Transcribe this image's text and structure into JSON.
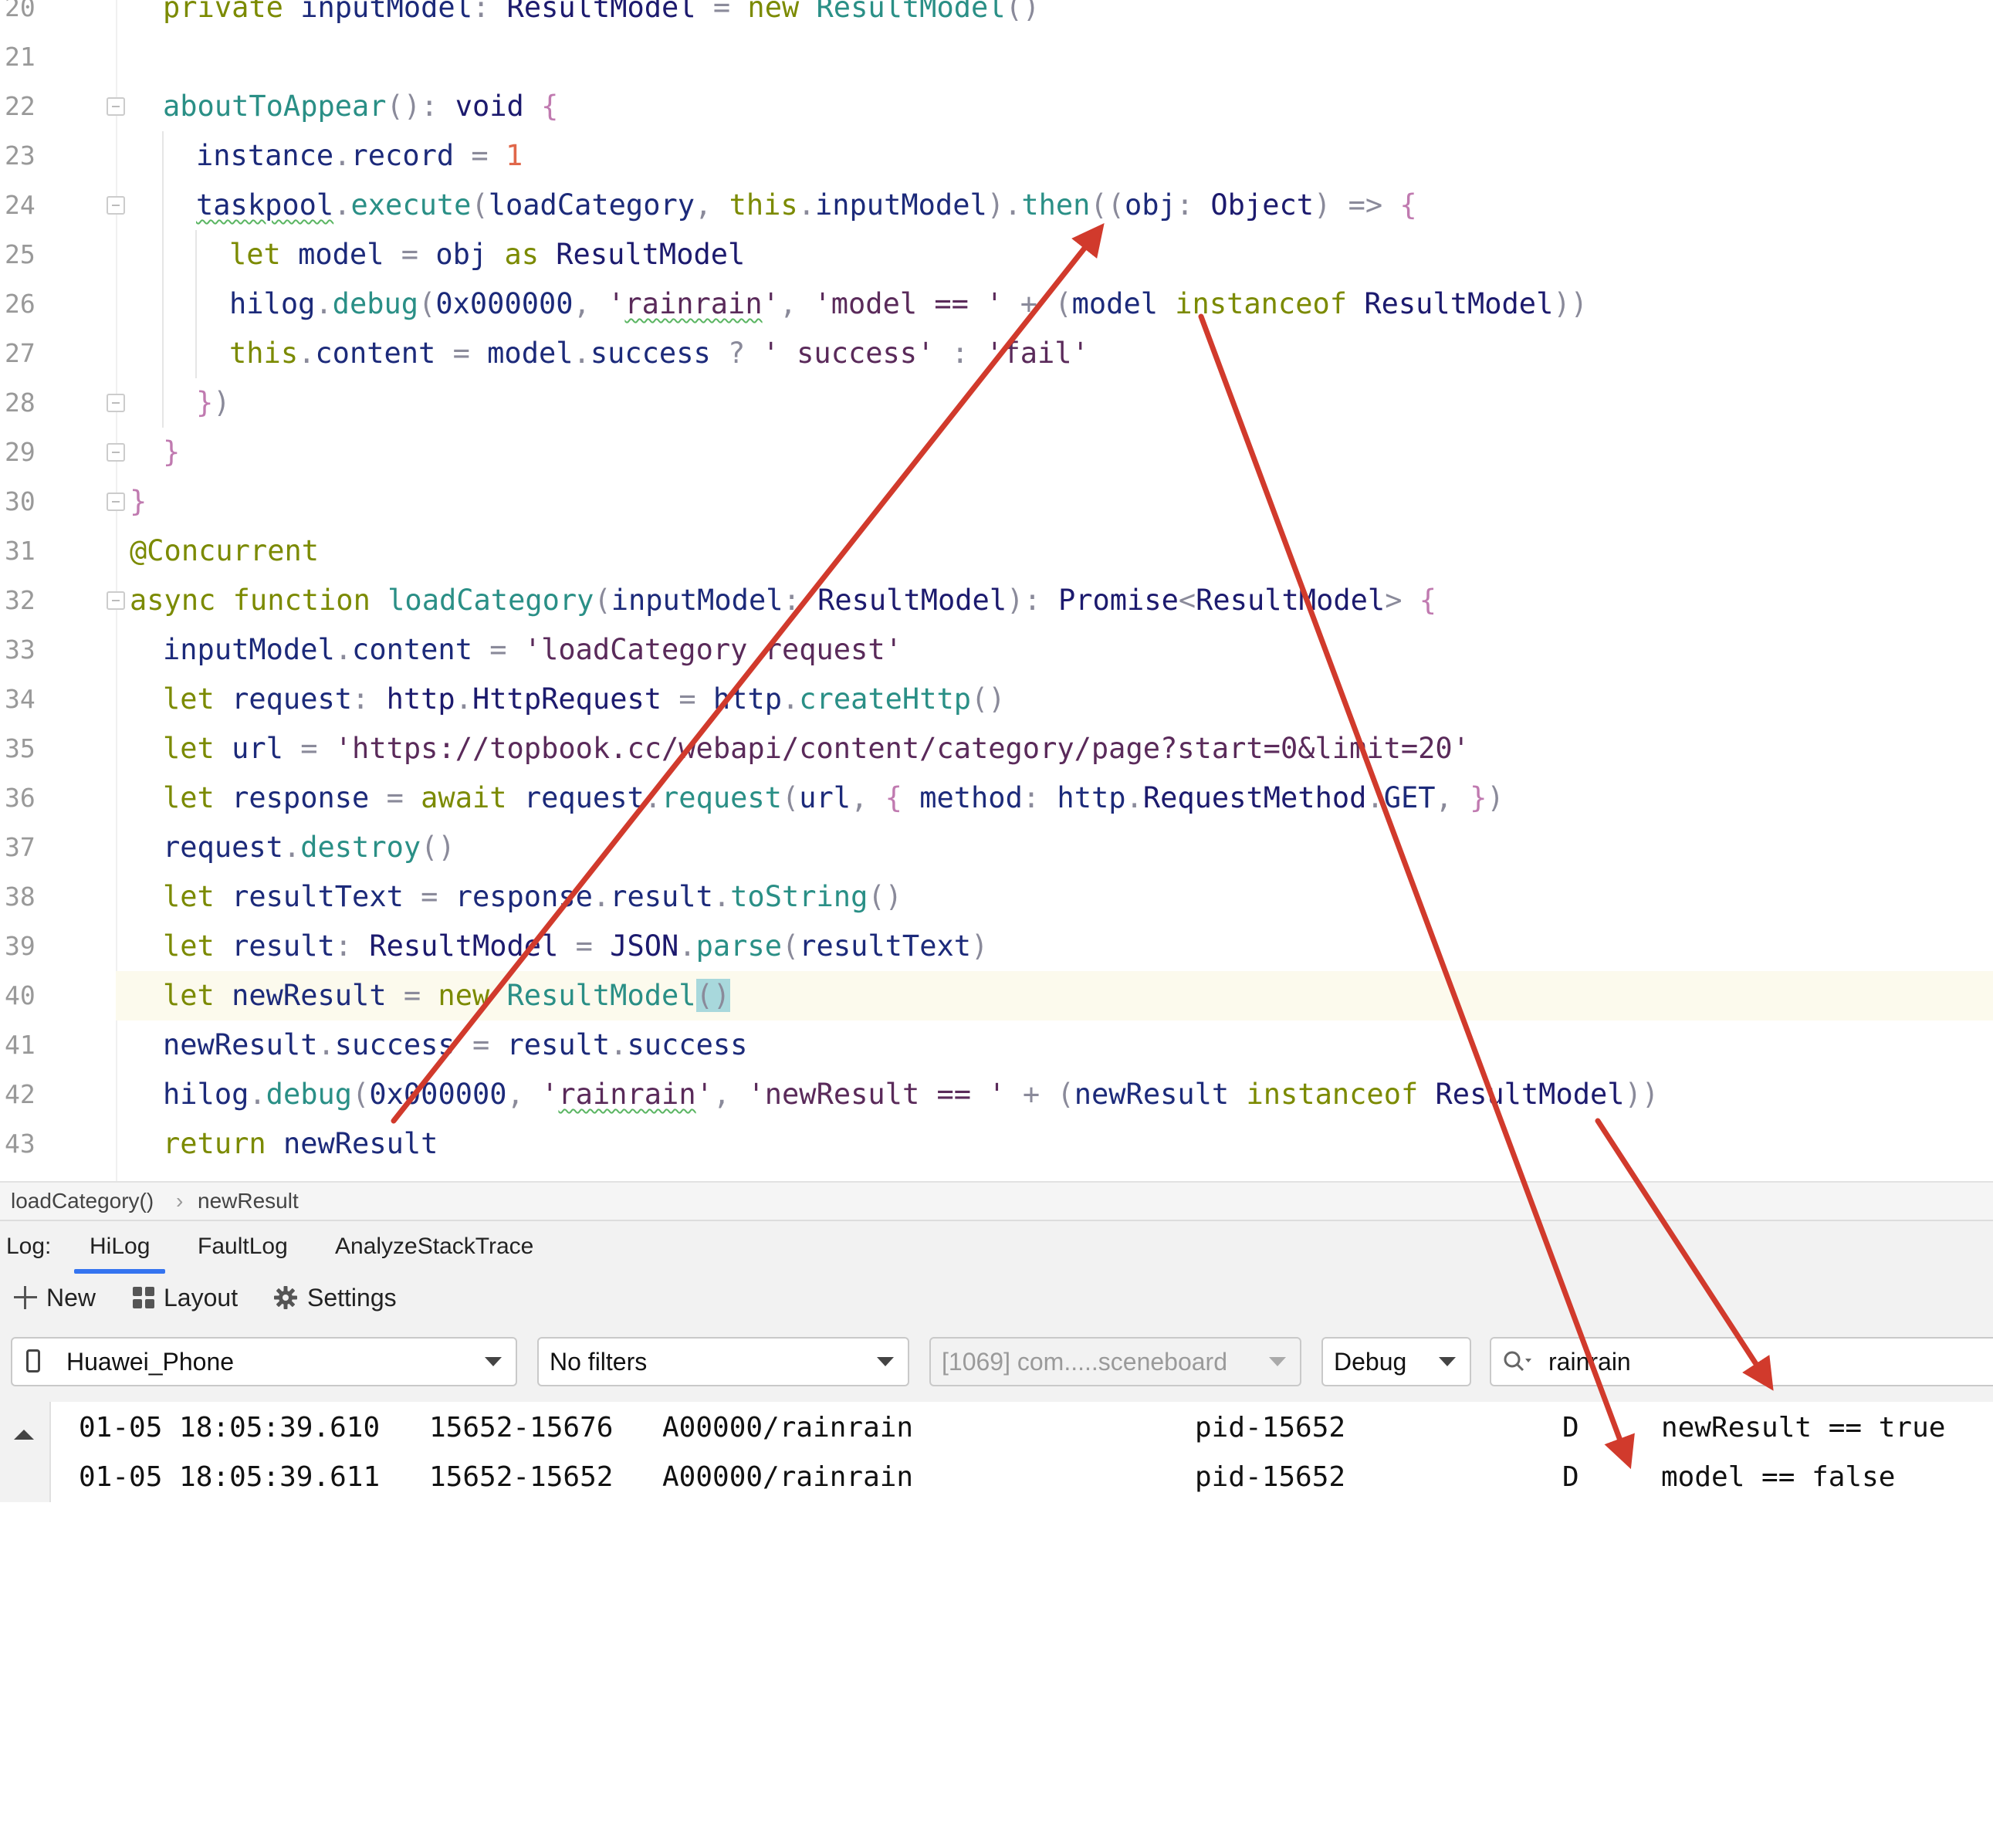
{
  "editor": {
    "lines": [
      {
        "n": "20",
        "indent": 1,
        "fold": false,
        "current": false,
        "tokens": [
          {
            "t": "private ",
            "c": "kw"
          },
          {
            "t": "inputModel",
            "c": "id"
          },
          {
            "t": ": ",
            "c": "pu"
          },
          {
            "t": "ResultModel",
            "c": "ty"
          },
          {
            "t": " = ",
            "c": "pu"
          },
          {
            "t": "new ",
            "c": "kw"
          },
          {
            "t": "ResultModel",
            "c": "fn"
          },
          {
            "t": "()",
            "c": "pu"
          }
        ]
      },
      {
        "n": "21",
        "indent": 0,
        "fold": false,
        "current": false,
        "tokens": []
      },
      {
        "n": "22",
        "indent": 1,
        "fold": true,
        "current": false,
        "tokens": [
          {
            "t": "aboutToAppear",
            "c": "fn"
          },
          {
            "t": "(): ",
            "c": "pu"
          },
          {
            "t": "void",
            "c": "ty"
          },
          {
            "t": " {",
            "c": "br"
          }
        ]
      },
      {
        "n": "23",
        "indent": 2,
        "fold": false,
        "current": false,
        "tokens": [
          {
            "t": "instance",
            "c": "id"
          },
          {
            "t": ".",
            "c": "pu"
          },
          {
            "t": "record",
            "c": "id"
          },
          {
            "t": " = ",
            "c": "pu"
          },
          {
            "t": "1",
            "c": "num"
          }
        ]
      },
      {
        "n": "24",
        "indent": 2,
        "fold": true,
        "current": false,
        "tokens": [
          {
            "t": "taskpool",
            "c": "id",
            "sq": true
          },
          {
            "t": ".",
            "c": "pu"
          },
          {
            "t": "execute",
            "c": "fn"
          },
          {
            "t": "(",
            "c": "pu"
          },
          {
            "t": "loadCategory",
            "c": "id"
          },
          {
            "t": ", ",
            "c": "pu"
          },
          {
            "t": "this",
            "c": "kw"
          },
          {
            "t": ".",
            "c": "pu"
          },
          {
            "t": "inputModel",
            "c": "id"
          },
          {
            "t": ").",
            "c": "pu"
          },
          {
            "t": "then",
            "c": "fn"
          },
          {
            "t": "((",
            "c": "pu"
          },
          {
            "t": "obj",
            "c": "id"
          },
          {
            "t": ": ",
            "c": "pu"
          },
          {
            "t": "Object",
            "c": "ty"
          },
          {
            "t": ") => ",
            "c": "pu"
          },
          {
            "t": "{",
            "c": "br"
          }
        ]
      },
      {
        "n": "25",
        "indent": 3,
        "fold": false,
        "current": false,
        "tokens": [
          {
            "t": "let ",
            "c": "kw"
          },
          {
            "t": "model",
            "c": "id"
          },
          {
            "t": " = ",
            "c": "pu"
          },
          {
            "t": "obj ",
            "c": "id"
          },
          {
            "t": "as ",
            "c": "kw"
          },
          {
            "t": "ResultModel",
            "c": "ty"
          }
        ]
      },
      {
        "n": "26",
        "indent": 3,
        "fold": false,
        "current": false,
        "tokens": [
          {
            "t": "hilog",
            "c": "id"
          },
          {
            "t": ".",
            "c": "pu"
          },
          {
            "t": "debug",
            "c": "fn"
          },
          {
            "t": "(",
            "c": "pu"
          },
          {
            "t": "0x000000",
            "c": "id"
          },
          {
            "t": ", ",
            "c": "pu"
          },
          {
            "t": "'",
            "c": "str"
          },
          {
            "t": "rainrain",
            "c": "str",
            "sq": true
          },
          {
            "t": "'",
            "c": "str"
          },
          {
            "t": ", ",
            "c": "pu"
          },
          {
            "t": "'model == '",
            "c": "str"
          },
          {
            "t": " + ",
            "c": "pu"
          },
          {
            "t": "(",
            "c": "pu"
          },
          {
            "t": "model ",
            "c": "id"
          },
          {
            "t": "instanceof ",
            "c": "kw"
          },
          {
            "t": "ResultModel",
            "c": "ty"
          },
          {
            "t": "))",
            "c": "pu"
          }
        ]
      },
      {
        "n": "27",
        "indent": 3,
        "fold": false,
        "current": false,
        "tokens": [
          {
            "t": "this",
            "c": "kw"
          },
          {
            "t": ".",
            "c": "pu"
          },
          {
            "t": "content",
            "c": "id"
          },
          {
            "t": " = ",
            "c": "pu"
          },
          {
            "t": "model",
            "c": "id"
          },
          {
            "t": ".",
            "c": "pu"
          },
          {
            "t": "success",
            "c": "id"
          },
          {
            "t": " ? ",
            "c": "pu"
          },
          {
            "t": "' success'",
            "c": "str"
          },
          {
            "t": " : ",
            "c": "pu"
          },
          {
            "t": "'fail'",
            "c": "str"
          }
        ]
      },
      {
        "n": "28",
        "indent": 2,
        "fold": true,
        "current": false,
        "tokens": [
          {
            "t": "}",
            "c": "br"
          },
          {
            "t": ")",
            "c": "pu"
          }
        ]
      },
      {
        "n": "29",
        "indent": 1,
        "fold": true,
        "current": false,
        "tokens": [
          {
            "t": "}",
            "c": "br"
          }
        ]
      },
      {
        "n": "30",
        "indent": 0,
        "fold": true,
        "current": false,
        "tokens": [
          {
            "t": "}",
            "c": "br"
          }
        ]
      },
      {
        "n": "31",
        "indent": 0,
        "fold": false,
        "current": false,
        "tokens": [
          {
            "t": "@Concurrent",
            "c": "dec"
          }
        ]
      },
      {
        "n": "32",
        "indent": 0,
        "fold": true,
        "current": false,
        "tokens": [
          {
            "t": "async ",
            "c": "kw"
          },
          {
            "t": "function ",
            "c": "kw"
          },
          {
            "t": "loadCategory",
            "c": "fn"
          },
          {
            "t": "(",
            "c": "pu"
          },
          {
            "t": "inputModel",
            "c": "id"
          },
          {
            "t": ": ",
            "c": "pu"
          },
          {
            "t": "ResultModel",
            "c": "ty"
          },
          {
            "t": "): ",
            "c": "pu"
          },
          {
            "t": "Promise",
            "c": "ty"
          },
          {
            "t": "<",
            "c": "pu"
          },
          {
            "t": "ResultModel",
            "c": "ty"
          },
          {
            "t": "> ",
            "c": "pu"
          },
          {
            "t": "{",
            "c": "br"
          }
        ]
      },
      {
        "n": "33",
        "indent": 1,
        "fold": false,
        "current": false,
        "tokens": [
          {
            "t": "inputModel",
            "c": "id"
          },
          {
            "t": ".",
            "c": "pu"
          },
          {
            "t": "content",
            "c": "id"
          },
          {
            "t": " = ",
            "c": "pu"
          },
          {
            "t": "'loadCategory request'",
            "c": "str"
          }
        ]
      },
      {
        "n": "34",
        "indent": 1,
        "fold": false,
        "current": false,
        "tokens": [
          {
            "t": "let ",
            "c": "kw"
          },
          {
            "t": "request",
            "c": "id"
          },
          {
            "t": ": ",
            "c": "pu"
          },
          {
            "t": "http",
            "c": "ty"
          },
          {
            "t": ".",
            "c": "pu"
          },
          {
            "t": "HttpRequest",
            "c": "ty"
          },
          {
            "t": " = ",
            "c": "pu"
          },
          {
            "t": "http",
            "c": "id"
          },
          {
            "t": ".",
            "c": "pu"
          },
          {
            "t": "createHttp",
            "c": "fn"
          },
          {
            "t": "()",
            "c": "pu"
          }
        ]
      },
      {
        "n": "35",
        "indent": 1,
        "fold": false,
        "current": false,
        "tokens": [
          {
            "t": "let ",
            "c": "kw"
          },
          {
            "t": "url",
            "c": "id"
          },
          {
            "t": " = ",
            "c": "pu"
          },
          {
            "t": "'https://topbook.cc/webapi/content/category/page?start=0&limit=20'",
            "c": "str"
          }
        ]
      },
      {
        "n": "36",
        "indent": 1,
        "fold": false,
        "current": false,
        "tokens": [
          {
            "t": "let ",
            "c": "kw"
          },
          {
            "t": "response",
            "c": "id"
          },
          {
            "t": " = ",
            "c": "pu"
          },
          {
            "t": "await ",
            "c": "kw"
          },
          {
            "t": "request",
            "c": "id"
          },
          {
            "t": ".",
            "c": "pu"
          },
          {
            "t": "request",
            "c": "fn"
          },
          {
            "t": "(",
            "c": "pu"
          },
          {
            "t": "url",
            "c": "id"
          },
          {
            "t": ", ",
            "c": "pu"
          },
          {
            "t": "{ ",
            "c": "br"
          },
          {
            "t": "method",
            "c": "id"
          },
          {
            "t": ": ",
            "c": "pu"
          },
          {
            "t": "http",
            "c": "id"
          },
          {
            "t": ".",
            "c": "pu"
          },
          {
            "t": "RequestMethod",
            "c": "ty"
          },
          {
            "t": ".",
            "c": "pu"
          },
          {
            "t": "GET",
            "c": "id"
          },
          {
            "t": ", ",
            "c": "pu"
          },
          {
            "t": "}",
            "c": "br"
          },
          {
            "t": ")",
            "c": "pu"
          }
        ]
      },
      {
        "n": "37",
        "indent": 1,
        "fold": false,
        "current": false,
        "tokens": [
          {
            "t": "request",
            "c": "id"
          },
          {
            "t": ".",
            "c": "pu"
          },
          {
            "t": "destroy",
            "c": "fn"
          },
          {
            "t": "()",
            "c": "pu"
          }
        ]
      },
      {
        "n": "38",
        "indent": 1,
        "fold": false,
        "current": false,
        "tokens": [
          {
            "t": "let ",
            "c": "kw"
          },
          {
            "t": "resultText",
            "c": "id"
          },
          {
            "t": " = ",
            "c": "pu"
          },
          {
            "t": "response",
            "c": "id"
          },
          {
            "t": ".",
            "c": "pu"
          },
          {
            "t": "result",
            "c": "id"
          },
          {
            "t": ".",
            "c": "pu"
          },
          {
            "t": "toString",
            "c": "fn"
          },
          {
            "t": "()",
            "c": "pu"
          }
        ]
      },
      {
        "n": "39",
        "indent": 1,
        "fold": false,
        "current": false,
        "tokens": [
          {
            "t": "let ",
            "c": "kw"
          },
          {
            "t": "result",
            "c": "id"
          },
          {
            "t": ": ",
            "c": "pu"
          },
          {
            "t": "ResultModel",
            "c": "ty"
          },
          {
            "t": " = ",
            "c": "pu"
          },
          {
            "t": "JSON",
            "c": "ty"
          },
          {
            "t": ".",
            "c": "pu"
          },
          {
            "t": "parse",
            "c": "fn"
          },
          {
            "t": "(",
            "c": "pu"
          },
          {
            "t": "resultText",
            "c": "id"
          },
          {
            "t": ")",
            "c": "pu"
          }
        ]
      },
      {
        "n": "40",
        "indent": 1,
        "fold": false,
        "current": true,
        "tokens": [
          {
            "t": "let ",
            "c": "kw"
          },
          {
            "t": "newResult",
            "c": "id"
          },
          {
            "t": " = ",
            "c": "pu"
          },
          {
            "t": "new ",
            "c": "kw"
          },
          {
            "t": "ResultModel",
            "c": "fn"
          },
          {
            "t": "()",
            "c": "pu",
            "hl": true
          }
        ]
      },
      {
        "n": "41",
        "indent": 1,
        "fold": false,
        "current": false,
        "tokens": [
          {
            "t": "newResult",
            "c": "id"
          },
          {
            "t": ".",
            "c": "pu"
          },
          {
            "t": "success",
            "c": "id"
          },
          {
            "t": " = ",
            "c": "pu"
          },
          {
            "t": "result",
            "c": "id"
          },
          {
            "t": ".",
            "c": "pu"
          },
          {
            "t": "success",
            "c": "id"
          }
        ]
      },
      {
        "n": "42",
        "indent": 1,
        "fold": false,
        "current": false,
        "tokens": [
          {
            "t": "hilog",
            "c": "id"
          },
          {
            "t": ".",
            "c": "pu"
          },
          {
            "t": "debug",
            "c": "fn"
          },
          {
            "t": "(",
            "c": "pu"
          },
          {
            "t": "0x000000",
            "c": "id"
          },
          {
            "t": ", ",
            "c": "pu"
          },
          {
            "t": "'",
            "c": "str"
          },
          {
            "t": "rainrain",
            "c": "str",
            "sq": true
          },
          {
            "t": "'",
            "c": "str"
          },
          {
            "t": ", ",
            "c": "pu"
          },
          {
            "t": "'newResult == '",
            "c": "str"
          },
          {
            "t": " + ",
            "c": "pu"
          },
          {
            "t": "(",
            "c": "pu"
          },
          {
            "t": "newResult ",
            "c": "id"
          },
          {
            "t": "instanceof ",
            "c": "kw"
          },
          {
            "t": "ResultModel",
            "c": "ty"
          },
          {
            "t": "))",
            "c": "pu"
          }
        ]
      },
      {
        "n": "43",
        "indent": 1,
        "fold": false,
        "current": false,
        "tokens": [
          {
            "t": "return ",
            "c": "kw"
          },
          {
            "t": "newResult",
            "c": "id"
          }
        ]
      }
    ]
  },
  "breadcrumb": {
    "items": [
      "loadCategory()",
      "newResult"
    ],
    "separator": "›"
  },
  "log_panel": {
    "label": "Log:",
    "tabs": [
      {
        "label": "HiLog",
        "active": true
      },
      {
        "label": "FaultLog",
        "active": false
      },
      {
        "label": "AnalyzeStackTrace",
        "active": false
      }
    ],
    "toolbar": {
      "new_label": "New",
      "layout_label": "Layout",
      "settings_label": "Settings"
    },
    "filters": {
      "device": "Huawei_Phone",
      "filter": "No filters",
      "process": "[1069] com.....sceneboard",
      "level": "Debug",
      "search": "rainrain"
    },
    "rows": [
      {
        "time": "01-05 18:05:39.610",
        "pid_tid": "15652-15676",
        "tag": "A00000/rainrain",
        "process": "pid-15652",
        "level": "D",
        "message": "newResult == true"
      },
      {
        "time": "01-05 18:05:39.611",
        "pid_tid": "15652-15652",
        "tag": "A00000/rainrain",
        "process": "pid-15652",
        "level": "D",
        "message": "model == false"
      }
    ]
  },
  "colors": {
    "arrow": "#d13a2c",
    "active_tab": "#3574f0",
    "current_line": "#fcfaed"
  }
}
